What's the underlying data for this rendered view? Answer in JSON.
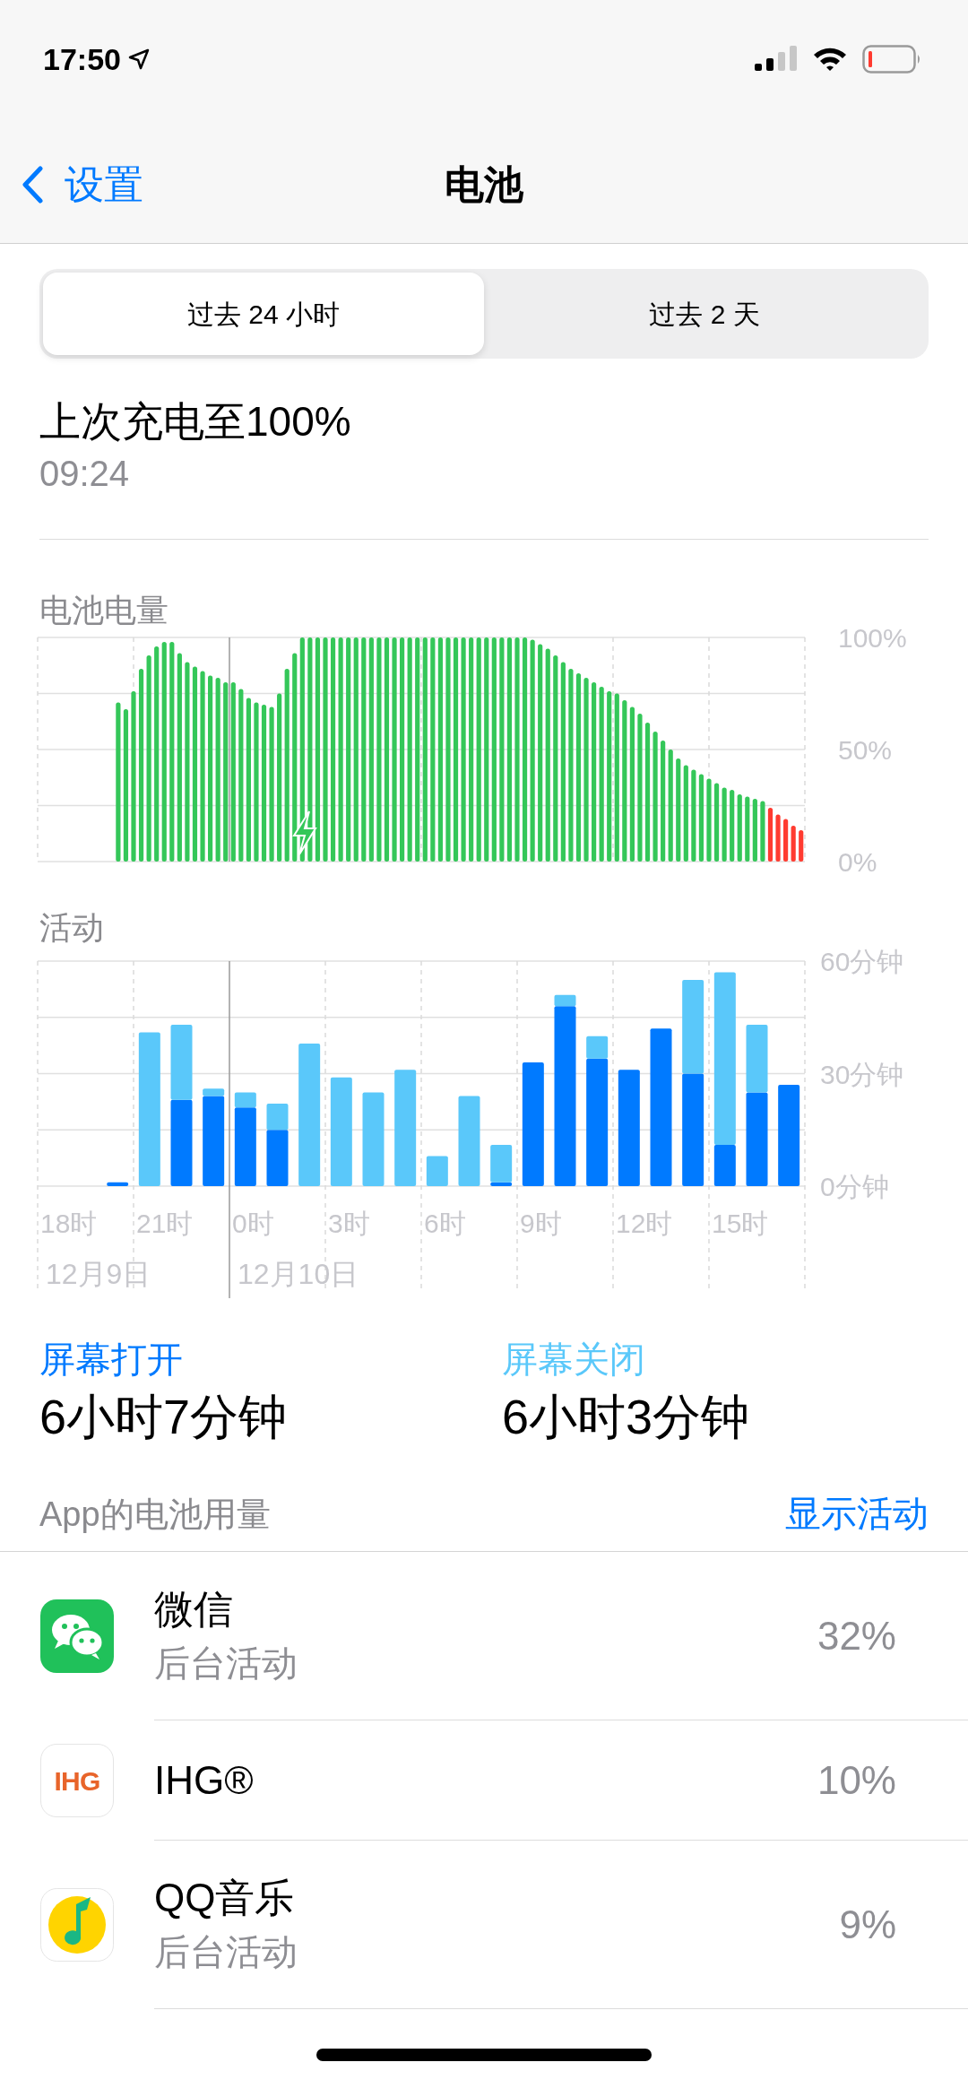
{
  "status_bar": {
    "time": "17:50"
  },
  "nav": {
    "back": "设置",
    "title": "电池"
  },
  "segments": [
    {
      "label": "过去 24 小时",
      "selected": true
    },
    {
      "label": "过去 2 天",
      "selected": false
    }
  ],
  "last_charge": {
    "title": "上次充电至100%",
    "time": "09:24"
  },
  "battery_level": {
    "title": "电池电量",
    "chart_data": {
      "type": "bar",
      "ylim": [
        0,
        100
      ],
      "yticks": [
        {
          "value": 100,
          "label": "100%"
        },
        {
          "value": 50,
          "label": "50%"
        },
        {
          "value": 0,
          "label": "0%"
        }
      ],
      "values": [
        null,
        null,
        null,
        null,
        null,
        null,
        null,
        null,
        null,
        null,
        71,
        68,
        76,
        86,
        92,
        96,
        98,
        98,
        93,
        89,
        87,
        85,
        83,
        82,
        80,
        80,
        77,
        73,
        71,
        70,
        69,
        75,
        86,
        93,
        100,
        100,
        100,
        100,
        100,
        100,
        100,
        100,
        100,
        100,
        100,
        100,
        100,
        100,
        100,
        100,
        100,
        100,
        100,
        100,
        100,
        100,
        100,
        100,
        100,
        100,
        100,
        100,
        100,
        100,
        99,
        97,
        95,
        92,
        89,
        86,
        84,
        82,
        80,
        78,
        76,
        75,
        72,
        69,
        66,
        62,
        58,
        54,
        50,
        46,
        43,
        41,
        39,
        37,
        35,
        33,
        32,
        30,
        29,
        28,
        27,
        24,
        21,
        19,
        16,
        14
      ]
    }
  },
  "activity": {
    "title": "活动",
    "chart_data": {
      "type": "bar",
      "stacked": true,
      "grid": true,
      "ylim": [
        0,
        60
      ],
      "yticks": [
        {
          "value": 60,
          "label": "60分钟"
        },
        {
          "value": 30,
          "label": "30分钟"
        },
        {
          "value": 0,
          "label": "0分钟"
        }
      ],
      "categories": [
        "18时",
        null,
        null,
        "21时",
        null,
        null,
        "0时",
        null,
        null,
        "3时",
        null,
        null,
        "6时",
        null,
        null,
        "9时",
        null,
        null,
        "12时",
        null,
        null,
        "15时",
        null,
        null
      ],
      "series": [
        {
          "name": "屏幕打开",
          "color": "#007aff",
          "values": [
            0,
            0,
            1,
            0,
            23,
            24,
            21,
            15,
            0,
            0,
            0,
            0,
            0,
            0,
            1,
            33,
            48,
            34,
            31,
            42,
            30,
            11,
            25,
            27
          ]
        },
        {
          "name": "屏幕关闭",
          "color": "#5ac8fa",
          "values": [
            0,
            0,
            0,
            41,
            20,
            2,
            4,
            7,
            38,
            29,
            25,
            31,
            8,
            24,
            10,
            0,
            3,
            6,
            0,
            0,
            25,
            46,
            18,
            0
          ]
        }
      ]
    },
    "date_labels": [
      {
        "text": "12月9日"
      },
      {
        "text": "12月10日"
      }
    ]
  },
  "screen_time": [
    {
      "value": "6小时7分钟"
    },
    {
      "value": "6小时3分钟"
    }
  ],
  "usage": {
    "title": "App的电池用量",
    "action": "显示活动",
    "apps": [
      {
        "kind": "wechat",
        "name": "微信",
        "detail": "后台活动",
        "percent": "32%"
      },
      {
        "kind": "ihg",
        "icon_text": "IHG",
        "name": "IHG®",
        "percent": "10%"
      },
      {
        "kind": "qqmusic",
        "name": "QQ音乐",
        "detail": "后台活动",
        "percent": "9%"
      }
    ]
  }
}
